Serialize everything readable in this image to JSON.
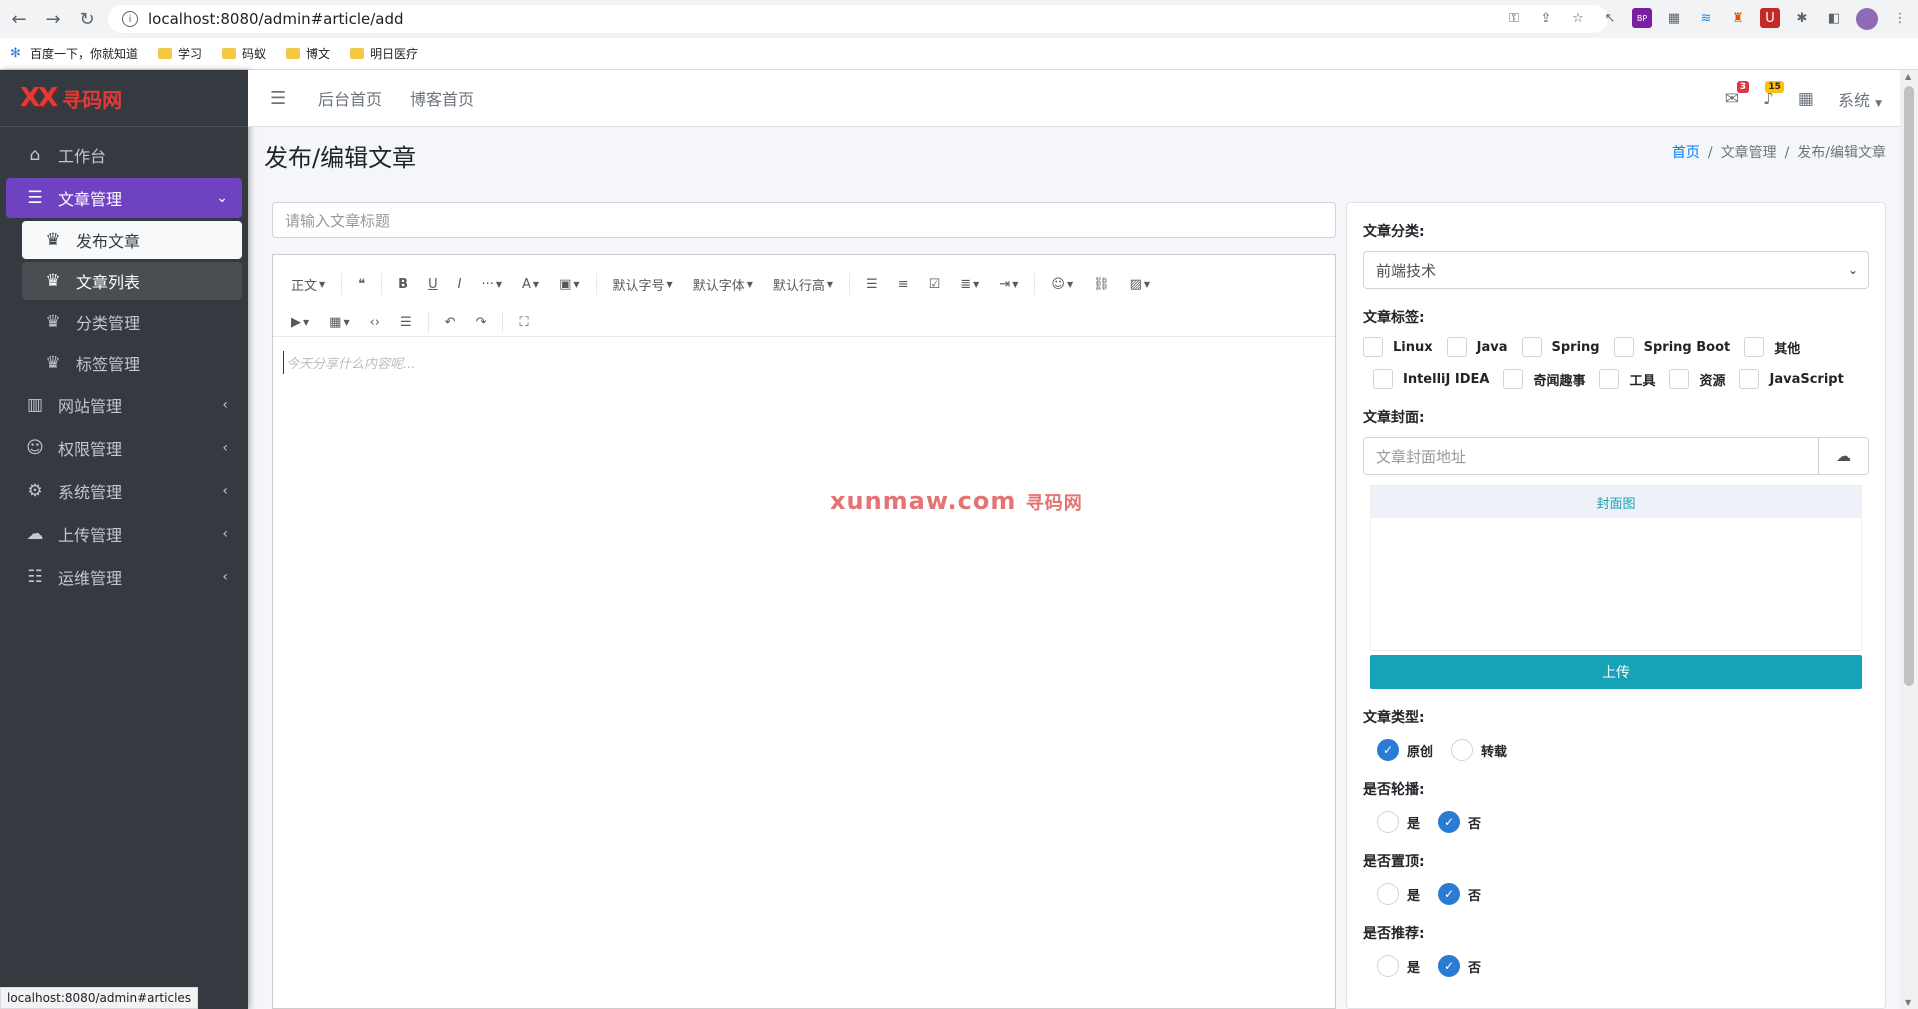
{
  "browser": {
    "url": "localhost:8080/admin#article/add",
    "status_url": "localhost:8080/admin#articles",
    "bookmarks": [
      "百度一下，你就知道",
      "学习",
      "码蚁",
      "博文",
      "明日医疗"
    ]
  },
  "brand": {
    "logo": "XX",
    "name": "寻码网"
  },
  "sidebar": {
    "items": [
      {
        "label": "工作台",
        "icon": "home-icon"
      },
      {
        "label": "文章管理",
        "icon": "list-icon"
      },
      {
        "label": "网站管理",
        "icon": "columns-icon"
      },
      {
        "label": "权限管理",
        "icon": "users-cog-icon"
      },
      {
        "label": "系统管理",
        "icon": "gear-icon"
      },
      {
        "label": "上传管理",
        "icon": "cloud-upload-icon"
      },
      {
        "label": "运维管理",
        "icon": "people-icon"
      }
    ],
    "sub": [
      {
        "label": "发布文章"
      },
      {
        "label": "文章列表"
      },
      {
        "label": "分类管理"
      },
      {
        "label": "标签管理"
      }
    ]
  },
  "header": {
    "links": [
      "后台首页",
      "博客首页"
    ],
    "messages_count": "3",
    "notifications_count": "15",
    "system_menu": "系统"
  },
  "page": {
    "title": "发布/编辑文章",
    "breadcrumb": [
      "首页",
      "文章管理",
      "发布/编辑文章"
    ]
  },
  "editor": {
    "title_placeholder": "请输入文章标题",
    "toolbar": {
      "paragraph": "正文",
      "font_size": "默认字号",
      "font_family": "默认字体",
      "line_height": "默认行高"
    },
    "placeholder": "今天分享什么内容呢..."
  },
  "watermark": {
    "main": "xunmaw.com",
    "sub": "寻码网"
  },
  "form": {
    "category_label": "文章分类:",
    "category_value": "前端技术",
    "tags_label": "文章标签:",
    "tags": [
      "Linux",
      "Java",
      "Spring",
      "Spring Boot",
      "其他",
      "IntelliJ IDEA",
      "奇闻趣事",
      "工具",
      "资源",
      "JavaScript"
    ],
    "cover_label": "文章封面:",
    "cover_placeholder": "文章封面地址",
    "cover_preview_label": "封面图",
    "upload_label": "上传",
    "type_label": "文章类型:",
    "type_options": [
      "原创",
      "转载"
    ],
    "carousel_label": "是否轮播:",
    "top_label": "是否置顶:",
    "recommend_label": "是否推荐:",
    "yes": "是",
    "no": "否"
  }
}
